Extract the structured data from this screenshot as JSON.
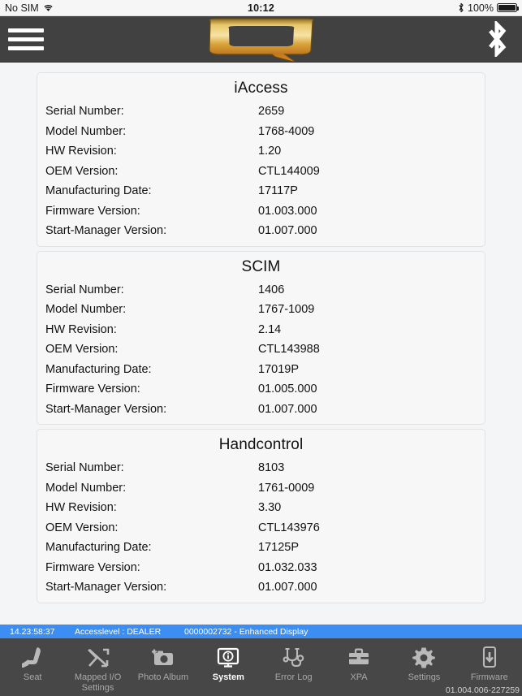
{
  "ios_status": {
    "carrier": "No SIM",
    "wifi_icon": "wifi-icon",
    "time": "10:12",
    "bluetooth_icon": "bluetooth-icon",
    "battery_percent": "100%",
    "battery_icon": "battery-full-icon"
  },
  "header": {
    "menu_icon": "hamburger-menu-icon",
    "logo": "q-logo",
    "bluetooth_icon": "bluetooth-icon"
  },
  "cards": [
    {
      "title": "iAccess",
      "rows": [
        {
          "label": "Serial Number:",
          "value": "2659"
        },
        {
          "label": "Model Number:",
          "value": "1768-4009"
        },
        {
          "label": "HW Revision:",
          "value": "1.20"
        },
        {
          "label": "OEM Version:",
          "value": "CTL144009"
        },
        {
          "label": "Manufacturing Date:",
          "value": "17117P"
        },
        {
          "label": "Firmware Version:",
          "value": "01.003.000"
        },
        {
          "label": "Start-Manager Version:",
          "value": "01.007.000"
        }
      ]
    },
    {
      "title": "SCIM",
      "rows": [
        {
          "label": "Serial Number:",
          "value": "1406"
        },
        {
          "label": "Model Number:",
          "value": "1767-1009"
        },
        {
          "label": "HW Revision:",
          "value": "2.14"
        },
        {
          "label": "OEM Version:",
          "value": "CTL143988"
        },
        {
          "label": "Manufacturing Date:",
          "value": "17019P"
        },
        {
          "label": "Firmware Version:",
          "value": "01.005.000"
        },
        {
          "label": "Start-Manager Version:",
          "value": "01.007.000"
        }
      ]
    },
    {
      "title": "Handcontrol",
      "rows": [
        {
          "label": "Serial Number:",
          "value": "8103"
        },
        {
          "label": "Model Number:",
          "value": "1761-0009"
        },
        {
          "label": "HW Revision:",
          "value": "3.30"
        },
        {
          "label": "OEM Version:",
          "value": "CTL143976"
        },
        {
          "label": "Manufacturing Date:",
          "value": "17125P"
        },
        {
          "label": "Firmware Version:",
          "value": "01.032.033"
        },
        {
          "label": "Start-Manager Version:",
          "value": "01.007.000"
        }
      ]
    }
  ],
  "status_strip": {
    "timestamp": "14.23:58:37",
    "accesslevel": "Accesslevel : DEALER",
    "device": "0000002732 - Enhanced Display",
    "background_color": "#3c8ef2"
  },
  "tabbar": {
    "items": [
      {
        "label": "Seat",
        "icon": "seat-icon",
        "active": false
      },
      {
        "label": "Mapped I/O\nSettings",
        "icon": "mapped-io-icon",
        "active": false
      },
      {
        "label": "Photo Album",
        "icon": "camera-icon",
        "active": false
      },
      {
        "label": "System",
        "icon": "monitor-info-icon",
        "active": true
      },
      {
        "label": "Error Log",
        "icon": "stethoscope-icon",
        "active": false
      },
      {
        "label": "XPA",
        "icon": "briefcase-icon",
        "active": false
      },
      {
        "label": "Settings",
        "icon": "gear-icon",
        "active": false
      },
      {
        "label": "Firmware",
        "icon": "phone-download-icon",
        "active": false
      }
    ],
    "app_version": "01.004.006-227259",
    "active_color": "#ffffff",
    "inactive_color": "#a8a8a8",
    "background_color": "#474747"
  }
}
